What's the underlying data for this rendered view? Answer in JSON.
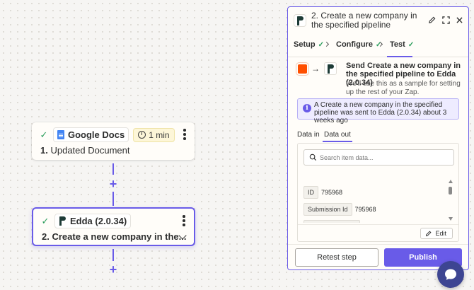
{
  "steps": [
    {
      "number": "1.",
      "title": "Updated Document",
      "app_name": "Google Docs",
      "duration": "1 min",
      "status": "complete"
    },
    {
      "number": "2.",
      "title": "Create a new company in the...",
      "app_name": "Edda (2.0.34)",
      "status": "complete"
    }
  ],
  "panel": {
    "step_number": "2.",
    "title": "Create a new company in the specified pipeline",
    "tabs": [
      {
        "label": "Setup",
        "status": "complete"
      },
      {
        "label": "Configure",
        "status": "complete"
      },
      {
        "label": "Test",
        "status": "complete",
        "active": true
      }
    ],
    "send_title": "Send Create a new company in the specified pipeline to Edda (2.0.34)",
    "send_subtitle": "We'll use this as a sample for setting up the rest of your Zap.",
    "info_message": "A Create a new company in the specified pipeline was sent to Edda (2.0.34) about 3 weeks ago",
    "data_tabs": [
      {
        "label": "Data in",
        "active": false
      },
      {
        "label": "Data out",
        "active": true
      }
    ],
    "search_placeholder": "Search item data...",
    "fields": [
      {
        "key": "ID",
        "value": "795968"
      },
      {
        "key": "Submission Id",
        "value": "795968"
      }
    ],
    "edit_label": "Edit",
    "retest_label": "Retest step",
    "publish_label": "Publish"
  },
  "colors": {
    "accent": "#695be8",
    "success": "#2a9d5b",
    "trigger_app": "#ff4f00",
    "chat_button": "#3d4592"
  },
  "icons": [
    "check-icon",
    "google-docs-icon",
    "clock-icon",
    "more-vertical-icon",
    "edda-logo-icon",
    "chevron-down-icon",
    "plus-icon",
    "pencil-icon",
    "expand-icon",
    "close-icon",
    "arrow-right-icon",
    "info-icon",
    "search-icon",
    "chat-icon"
  ]
}
